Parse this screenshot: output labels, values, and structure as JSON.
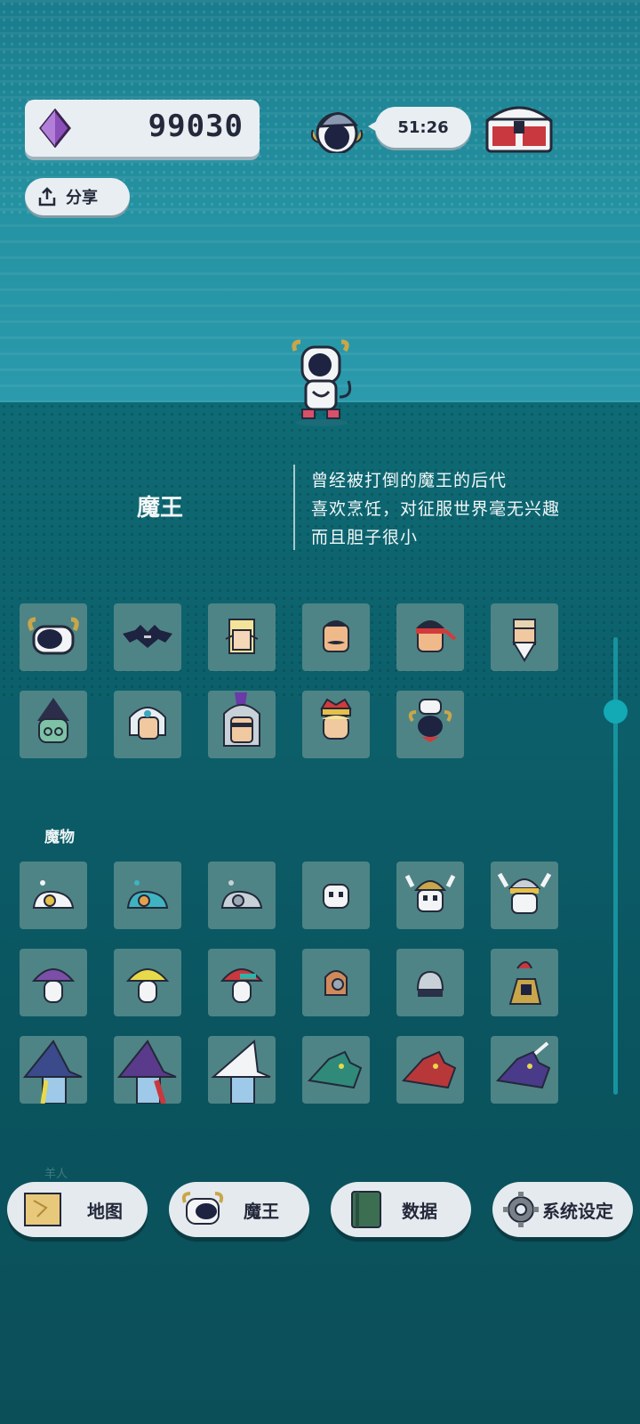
{
  "currency": {
    "amount": "99030",
    "icon": "purple-gem-icon"
  },
  "timer": "51:26",
  "share": {
    "label": "分享"
  },
  "selected_character": {
    "name": "魔王",
    "description": [
      "曾经被打倒的魔王的后代",
      "喜欢烹饪，对征服世界毫无兴趣",
      "而且胆子很小"
    ]
  },
  "sections": {
    "monsters_label": "魔物",
    "next_label_faded": "羊人"
  },
  "heroes_row": [
    "demon-lord-icon",
    "bat-icon",
    "elf-icon",
    "mustache-man-icon",
    "headband-fighter-icon",
    "old-sage-icon",
    "witch-girl-icon",
    "white-hair-hero-icon",
    "knight-icon",
    "king-icon",
    "chef-demon-icon"
  ],
  "monsters": [
    "egg-slime-icon",
    "teal-slime-icon",
    "gray-slime-icon",
    "skull-icon",
    "horned-skull-icon",
    "crowned-skull-icon",
    "purple-mushroom-icon",
    "yellow-mushroom-icon",
    "red-mushroom-icon",
    "bronze-helmet-icon",
    "silver-helmet-icon",
    "red-plume-helmet-icon",
    "blue-witch-icon",
    "purple-witch-icon",
    "white-witch-icon",
    "green-dragon-icon",
    "red-dragon-icon",
    "purple-dragon-icon"
  ],
  "nav": {
    "map": "地图",
    "demon_lord": "魔王",
    "data": "数据",
    "settings": "系统设定"
  },
  "colors": {
    "accent": "#13a9b5",
    "button_bg": "#e4eaee",
    "text_dark": "#23293a"
  }
}
